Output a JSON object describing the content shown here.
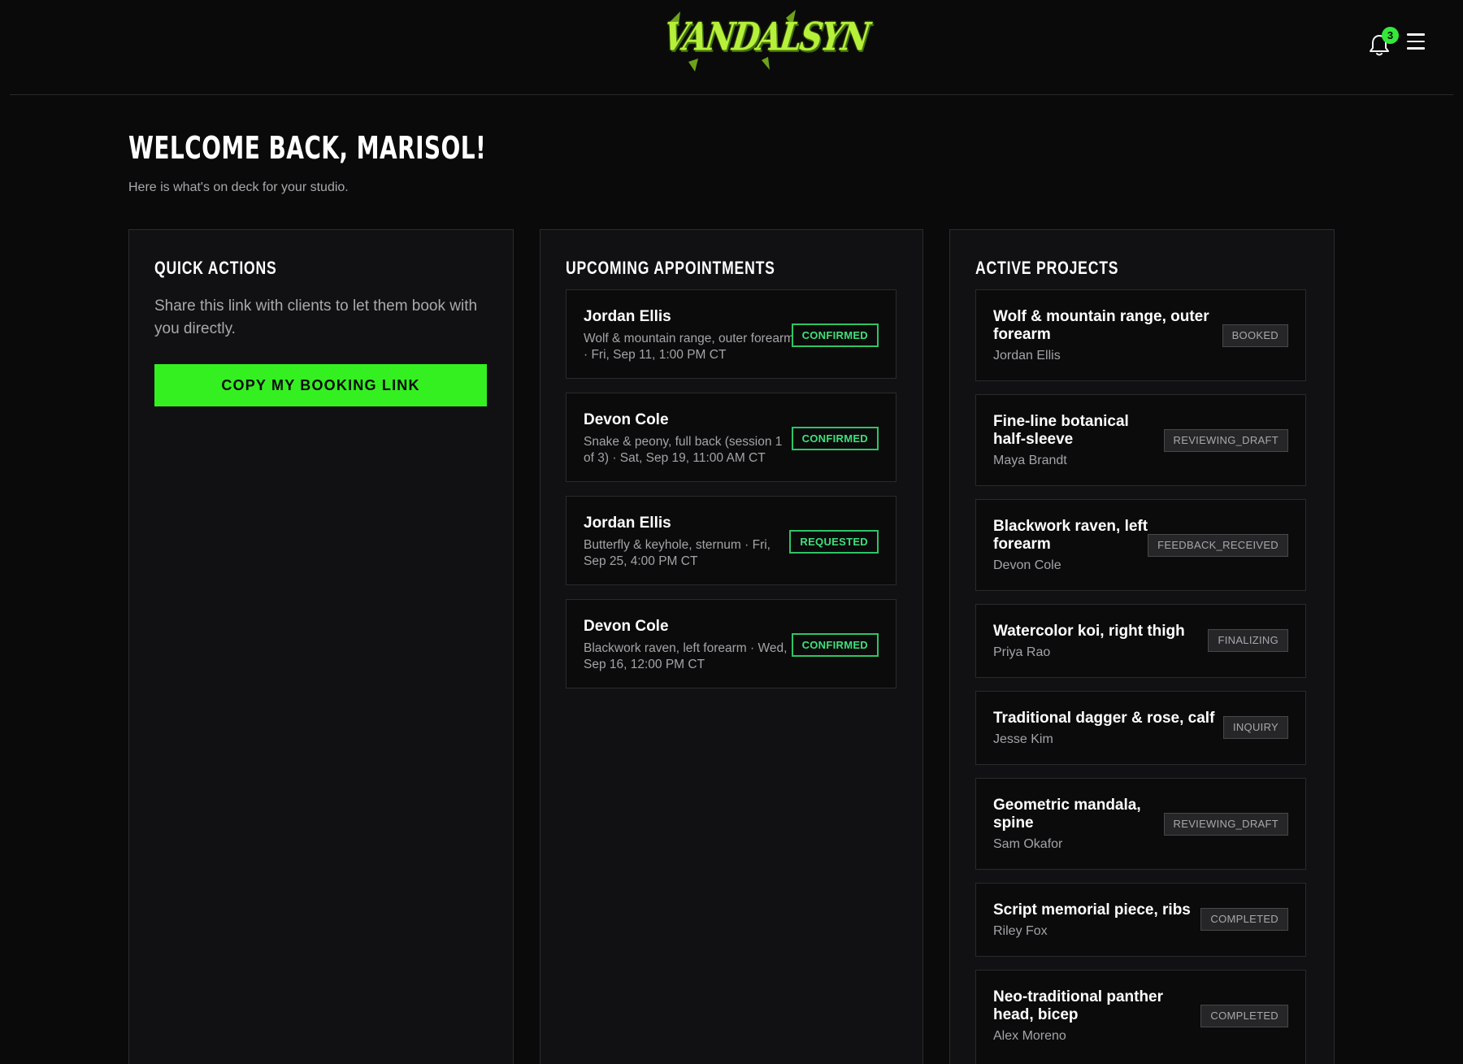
{
  "header": {
    "logo_text": "VANDALSYN",
    "notification_count": "3",
    "icons": {
      "notifications": "bell-icon",
      "menu": "hamburger-menu-icon"
    }
  },
  "welcome": {
    "title": "WELCOME BACK, MARISOL!",
    "subtitle": "Here is what's on deck for your studio."
  },
  "quick_actions": {
    "title": "QUICK ACTIONS",
    "description": "Share this link with clients to let them book with you directly.",
    "button_label": "COPY MY BOOKING LINK"
  },
  "appointments": {
    "title": "UPCOMING APPOINTMENTS",
    "items": [
      {
        "client": "Jordan Ellis",
        "details": "Wolf & mountain range, outer forearm · Fri, Sep 11, 1:00 PM CT",
        "status": "CONFIRMED"
      },
      {
        "client": "Devon Cole",
        "details": "Snake & peony, full back (session 1 of 3) · Sat, Sep 19, 11:00 AM CT",
        "status": "CONFIRMED"
      },
      {
        "client": "Jordan Ellis",
        "details": "Butterfly & keyhole, sternum · Fri, Sep 25, 4:00 PM CT",
        "status": "REQUESTED"
      },
      {
        "client": "Devon Cole",
        "details": "Blackwork raven, left forearm · Wed, Sep 16, 12:00 PM CT",
        "status": "CONFIRMED"
      }
    ]
  },
  "projects": {
    "title": "ACTIVE PROJECTS",
    "items": [
      {
        "name": "Wolf & mountain range, outer forearm",
        "client": "Jordan Ellis",
        "status": "BOOKED"
      },
      {
        "name": "Fine-line botanical half-sleeve",
        "client": "Maya Brandt",
        "status": "REVIEWING_DRAFT"
      },
      {
        "name": "Blackwork raven, left forearm",
        "client": "Devon Cole",
        "status": "FEEDBACK_RECEIVED"
      },
      {
        "name": "Watercolor koi, right thigh",
        "client": "Priya Rao",
        "status": "FINALIZING"
      },
      {
        "name": "Traditional dagger & rose, calf",
        "client": "Jesse Kim",
        "status": "INQUIRY"
      },
      {
        "name": "Geometric mandala, spine",
        "client": "Sam Okafor",
        "status": "REVIEWING_DRAFT"
      },
      {
        "name": "Script memorial piece, ribs",
        "client": "Riley Fox",
        "status": "COMPLETED"
      },
      {
        "name": "Neo-traditional panther head, bicep",
        "client": "Alex Moreno",
        "status": "COMPLETED"
      }
    ]
  },
  "colors": {
    "accent": "#34f021",
    "background": "#0a0a0b",
    "panel": "#111113",
    "status_green": "#3fe07a",
    "status_neutral": "#a8a8ac"
  }
}
